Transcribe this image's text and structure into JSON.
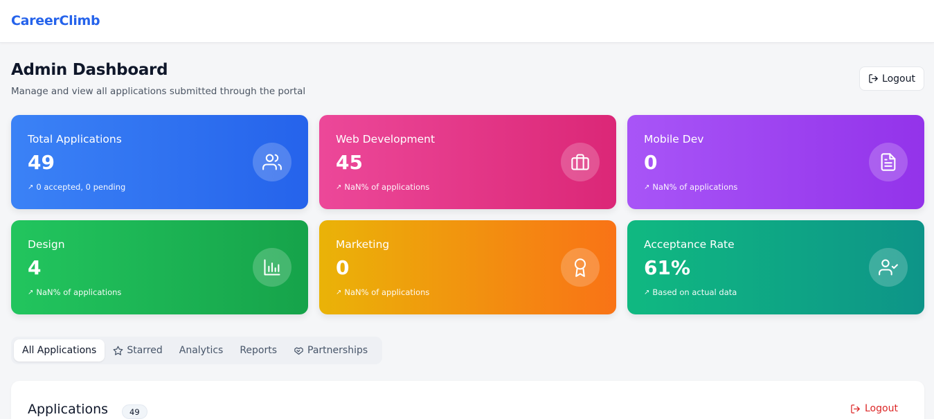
{
  "app": {
    "brand": "CareerClimb"
  },
  "header": {
    "title": "Admin Dashboard",
    "subtitle": "Manage and view all applications submitted through the portal",
    "logout_label": "Logout"
  },
  "stats": [
    {
      "title": "Total Applications",
      "value": "49",
      "note": "0 accepted, 0 pending",
      "icon": "users-icon",
      "color": "#2563eb"
    },
    {
      "title": "Web Development",
      "value": "45",
      "note": "NaN% of applications",
      "icon": "briefcase-icon",
      "color": "#db2777"
    },
    {
      "title": "Mobile Dev",
      "value": "0",
      "note": "NaN% of applications",
      "icon": "file-text-icon",
      "color": "#9333ea"
    },
    {
      "title": "Design",
      "value": "4",
      "note": "NaN% of applications",
      "icon": "bar-chart-icon",
      "color": "#16a34a"
    },
    {
      "title": "Marketing",
      "value": "0",
      "note": "NaN% of applications",
      "icon": "award-icon",
      "color": "#f97316"
    },
    {
      "title": "Acceptance Rate",
      "value": "61%",
      "note": "Based on actual data",
      "icon": "user-check-icon",
      "color": "#0d9488"
    }
  ],
  "tabs": [
    {
      "label": "All Applications",
      "active": true
    },
    {
      "label": "Starred",
      "icon": "star-icon"
    },
    {
      "label": "Analytics"
    },
    {
      "label": "Reports"
    },
    {
      "label": "Partnerships",
      "icon": "handshake-icon"
    }
  ],
  "applications": {
    "title": "Applications",
    "count": "49",
    "logout_label": "Logout"
  }
}
